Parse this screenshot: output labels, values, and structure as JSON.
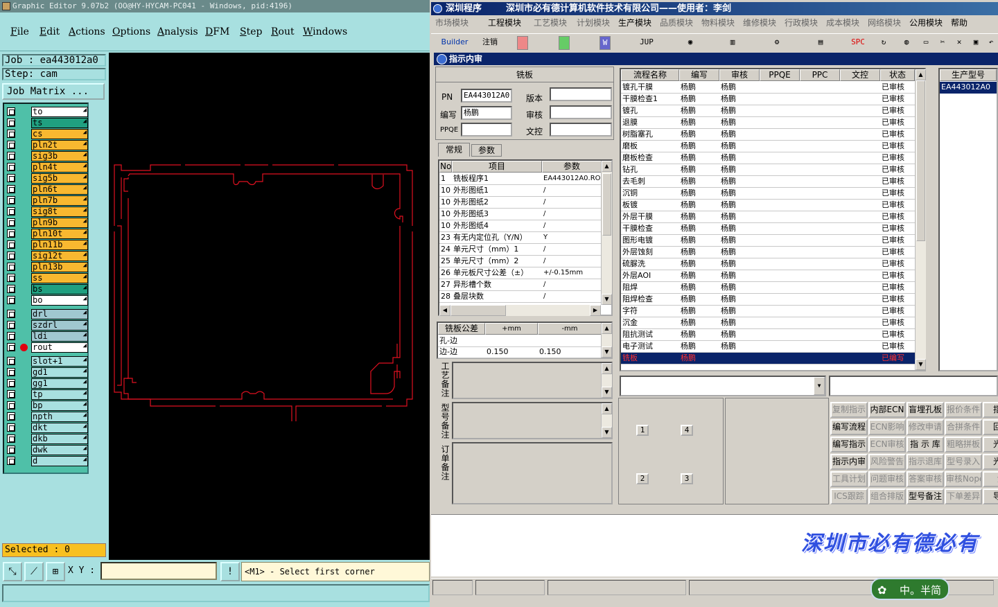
{
  "ge": {
    "title": "Graphic Editor 9.07b2 (OO@HY-HYCAM-PC041 - Windows, pid:4196)",
    "menu": [
      "File",
      "Edit",
      "Actions",
      "Options",
      "Analysis",
      "DFM",
      "Step",
      "Rout",
      "Windows"
    ],
    "job": "Job : ea443012a0",
    "step": "Step: cam",
    "job_matrix": "Job Matrix ...",
    "layers": [
      {
        "name": "to",
        "color": "#ffffff"
      },
      {
        "name": "ts",
        "color": "#20a080"
      },
      {
        "name": "cs",
        "color": "#f8b830"
      },
      {
        "name": "pln2t",
        "color": "#f8b830"
      },
      {
        "name": "sig3b",
        "color": "#f8b830"
      },
      {
        "name": "pln4t",
        "color": "#f8b830"
      },
      {
        "name": "sig5b",
        "color": "#f8b830"
      },
      {
        "name": "pln6t",
        "color": "#f8b830"
      },
      {
        "name": "pln7b",
        "color": "#f8b830"
      },
      {
        "name": "sig8t",
        "color": "#f8b830"
      },
      {
        "name": "pln9b",
        "color": "#f8b830"
      },
      {
        "name": "pln10t",
        "color": "#f8b830"
      },
      {
        "name": "pln11b",
        "color": "#f8b830"
      },
      {
        "name": "sig12t",
        "color": "#f8b830"
      },
      {
        "name": "pln13b",
        "color": "#f8b830"
      },
      {
        "name": "ss",
        "color": "#f8b830"
      },
      {
        "name": "bs",
        "color": "#20a080"
      },
      {
        "name": "bo",
        "color": "#ffffff"
      }
    ],
    "drill_layers": [
      {
        "name": "drl",
        "color": "#a0c8d0"
      },
      {
        "name": "szdrl",
        "color": "#a0c8d0"
      },
      {
        "name": "ldi",
        "color": "#a0c8d0"
      },
      {
        "name": "rout",
        "color": "#ffffff",
        "active": true
      }
    ],
    "other_layers": [
      {
        "name": "slot+1",
        "color": "#a8e0e0"
      },
      {
        "name": "gd1",
        "color": "#a8e0e0"
      },
      {
        "name": "gg1",
        "color": "#a8e0e0"
      },
      {
        "name": "tp",
        "color": "#a8e0e0"
      },
      {
        "name": "bp",
        "color": "#a8e0e0"
      },
      {
        "name": "npth",
        "color": "#a8e0e0"
      },
      {
        "name": "dkt",
        "color": "#a8e0e0"
      },
      {
        "name": "dkb",
        "color": "#a8e0e0"
      },
      {
        "name": "dwk",
        "color": "#a8e0e0"
      },
      {
        "name": "d",
        "color": "#a8e0e0"
      }
    ],
    "selected": "Selected : 0",
    "xy_label": "X Y :",
    "prompt": "<M1> - Select first corner",
    "rout_color": "#e01020"
  },
  "sz": {
    "title_left": "深圳程序",
    "title_right": "深圳市必有德计算机软件技术有限公司——使用者：李剑",
    "menu": [
      "市场模块",
      "工程模块",
      "工艺模块",
      "计划模块",
      "生产模块",
      "品质模块",
      "物料模块",
      "维修模块",
      "行政模块",
      "成本模块",
      "网络模块",
      "公用模块",
      "帮助"
    ],
    "toolbar": {
      "builder": "Builder",
      "note": "注销",
      "jup": "JUP",
      "spc": "SPC"
    },
    "inner_title": "指示内审",
    "form": {
      "section": "铣板",
      "pn_label": "PN",
      "pn_value": "EA443012A0",
      "version_label": "版本",
      "version_value": "",
      "writer_label": "编写",
      "writer_value": "杨鹏",
      "audit_label": "审核",
      "audit_value": "",
      "ppqe_label": "PPQE",
      "ppqe_value": "",
      "wenkong_label": "文控",
      "wenkong_value": ""
    },
    "tabs": [
      "常规",
      "参数"
    ],
    "params": {
      "headers": [
        "No",
        "项目",
        "参数"
      ],
      "rows": [
        [
          "1",
          "铣板程序1",
          "EA443012A0.ROU"
        ],
        [
          "10",
          "外形图纸1",
          "/"
        ],
        [
          "10",
          "外形图纸2",
          "/"
        ],
        [
          "10",
          "外形图纸3",
          "/"
        ],
        [
          "10",
          "外形图纸4",
          "/"
        ],
        [
          "23",
          "有无内定位孔（Y/N）",
          "Y"
        ],
        [
          "24",
          "单元尺寸（mm）1",
          "/"
        ],
        [
          "25",
          "单元尺寸（mm）2",
          "/"
        ],
        [
          "26",
          "单元板尺寸公差（±）",
          "+/-0.15mm"
        ],
        [
          "27",
          "异形槽个数",
          "/"
        ],
        [
          "28",
          "叠层块数",
          "/"
        ]
      ]
    },
    "tolerance": {
      "headers": [
        "铣板公差",
        "+mm",
        "-mm"
      ],
      "rows": [
        [
          "孔-边",
          "",
          ""
        ],
        [
          "边-边",
          "0.150",
          "0.150"
        ]
      ]
    },
    "remarks": [
      "工艺备注",
      "型号备注",
      "订单备注"
    ],
    "flow": {
      "headers": [
        "流程名称",
        "编写",
        "审核",
        "PPQE",
        "PPC",
        "文控",
        "状态"
      ],
      "rows": [
        [
          "镀孔干膜",
          "杨鹏",
          "杨鹏",
          "",
          "",
          "",
          "已审核"
        ],
        [
          "干膜检查1",
          "杨鹏",
          "杨鹏",
          "",
          "",
          "",
          "已审核"
        ],
        [
          "镀孔",
          "杨鹏",
          "杨鹏",
          "",
          "",
          "",
          "已审核"
        ],
        [
          "退膜",
          "杨鹏",
          "杨鹏",
          "",
          "",
          "",
          "已审核"
        ],
        [
          "树脂塞孔",
          "杨鹏",
          "杨鹏",
          "",
          "",
          "",
          "已审核"
        ],
        [
          "磨板",
          "杨鹏",
          "杨鹏",
          "",
          "",
          "",
          "已审核"
        ],
        [
          "磨板检查",
          "杨鹏",
          "杨鹏",
          "",
          "",
          "",
          "已审核"
        ],
        [
          "钻孔",
          "杨鹏",
          "杨鹏",
          "",
          "",
          "",
          "已审核"
        ],
        [
          "去毛刺",
          "杨鹏",
          "杨鹏",
          "",
          "",
          "",
          "已审核"
        ],
        [
          "沉铜",
          "杨鹏",
          "杨鹏",
          "",
          "",
          "",
          "已审核"
        ],
        [
          "板镀",
          "杨鹏",
          "杨鹏",
          "",
          "",
          "",
          "已审核"
        ],
        [
          "外层干膜",
          "杨鹏",
          "杨鹏",
          "",
          "",
          "",
          "已审核"
        ],
        [
          "干膜检查",
          "杨鹏",
          "杨鹏",
          "",
          "",
          "",
          "已审核"
        ],
        [
          "图形电镀",
          "杨鹏",
          "杨鹏",
          "",
          "",
          "",
          "已审核"
        ],
        [
          "外层蚀刻",
          "杨鹏",
          "杨鹏",
          "",
          "",
          "",
          "已审核"
        ],
        [
          "硫脲洗",
          "杨鹏",
          "杨鹏",
          "",
          "",
          "",
          "已审核"
        ],
        [
          "外层AOI",
          "杨鹏",
          "杨鹏",
          "",
          "",
          "",
          "已审核"
        ],
        [
          "阻焊",
          "杨鹏",
          "杨鹏",
          "",
          "",
          "",
          "已审核"
        ],
        [
          "阻焊检查",
          "杨鹏",
          "杨鹏",
          "",
          "",
          "",
          "已审核"
        ],
        [
          "字符",
          "杨鹏",
          "杨鹏",
          "",
          "",
          "",
          "已审核"
        ],
        [
          "沉金",
          "杨鹏",
          "杨鹏",
          "",
          "",
          "",
          "已审核"
        ],
        [
          "阻抗测试",
          "杨鹏",
          "杨鹏",
          "",
          "",
          "",
          "已审核"
        ],
        [
          "电子测试",
          "杨鹏",
          "杨鹏",
          "",
          "",
          "",
          "已审核"
        ],
        [
          "铣板",
          "杨鹏",
          "",
          "",
          "",
          "",
          "已编写"
        ]
      ]
    },
    "model": {
      "header": "生产型号",
      "value": "EA443012A0"
    },
    "diagram_nums": [
      "1",
      "4",
      "2",
      "3"
    ],
    "buttons": [
      [
        "复制指示",
        "内部ECN",
        "盲埋孔板",
        "报价条件",
        "指示"
      ],
      [
        "编写流程",
        "ECN影响",
        "修改申请",
        "合拼条件",
        "回退"
      ],
      [
        "编写指示",
        "ECN审核",
        "指 示 库",
        "粗略拼板",
        "光绘"
      ],
      [
        "指示内审",
        "风险警告",
        "指示退库",
        "型号录入",
        "光绘"
      ],
      [
        "工具计划",
        "问题审核",
        "答案审核",
        "审核Nope",
        "测"
      ],
      [
        "ICS跟踪",
        "组合排版",
        "型号备注",
        "下单差异",
        "导入"
      ]
    ],
    "disabled_buttons": [
      "复制指示",
      "报价条件",
      "ECN影响",
      "修改申请",
      "合拼条件",
      "ECN审核",
      "粗略拼板",
      "风险警告",
      "指示退库",
      "型号录入",
      "工具计划",
      "问题审核",
      "答案审核",
      "审核Nope",
      "ICS跟踪",
      "组合排版",
      "下单差异"
    ],
    "watermark": "深圳市必有德必有",
    "ime": "中。半简",
    "colors": {
      "selected_row": "#0a246a",
      "selected_text": "#ff3030",
      "watermark": "#3050e0"
    }
  }
}
